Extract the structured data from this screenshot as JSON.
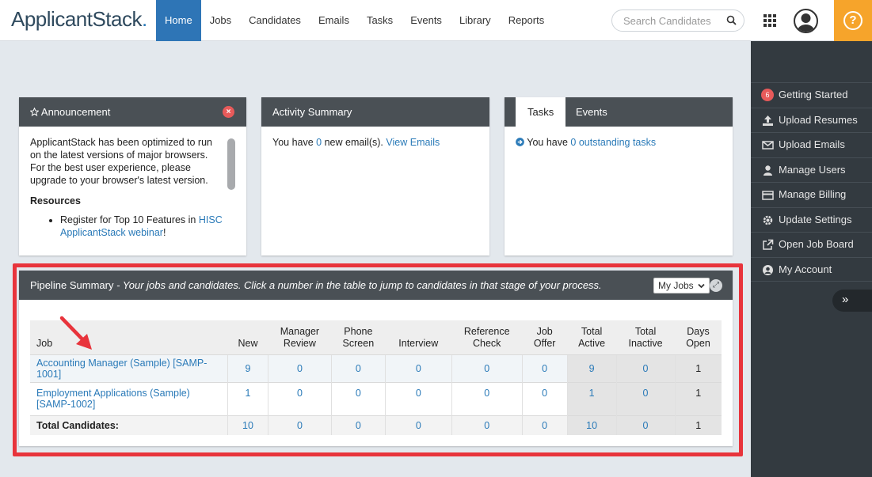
{
  "app": {
    "logo_text": "ApplicantStack",
    "logo_dot": "."
  },
  "nav": {
    "items": [
      {
        "label": "Home",
        "active": true
      },
      {
        "label": "Jobs"
      },
      {
        "label": "Candidates"
      },
      {
        "label": "Emails"
      },
      {
        "label": "Tasks"
      },
      {
        "label": "Events"
      },
      {
        "label": "Library"
      },
      {
        "label": "Reports"
      }
    ]
  },
  "search": {
    "placeholder": "Search Candidates",
    "icon": "search-icon"
  },
  "sidebar": {
    "items": [
      {
        "label": "Getting Started",
        "badge": "6",
        "icon": "badge"
      },
      {
        "label": "Upload Resumes",
        "icon": "upload-icon"
      },
      {
        "label": "Upload Emails",
        "icon": "envelope-icon"
      },
      {
        "label": "Manage Users",
        "icon": "user-icon"
      },
      {
        "label": "Manage Billing",
        "icon": "credit-card-icon"
      },
      {
        "label": "Update Settings",
        "icon": "gear-icon"
      },
      {
        "label": "Open Job Board",
        "icon": "external-link-icon"
      },
      {
        "label": "My Account",
        "icon": "user-circle-icon"
      }
    ],
    "collapse_label": "»"
  },
  "announcement": {
    "title": "Announcement",
    "body": "ApplicantStack has been optimized to run on the latest versions of major browsers. For the best user experience, please upgrade to your browser's latest version.",
    "resources_title": "Resources",
    "resource_prefix": "Register for Top 10 Features in ",
    "resource_link": "HISC ApplicantStack webinar",
    "resource_suffix": "!"
  },
  "activity": {
    "title": "Activity Summary",
    "prefix": "You have ",
    "count": "0",
    "middle": " new email(s). ",
    "link": "View Emails"
  },
  "tasks_panel": {
    "tab_tasks": "Tasks",
    "tab_events": "Events",
    "prefix": "You have ",
    "link": "0 outstanding tasks"
  },
  "pipeline": {
    "title": "Pipeline Summary",
    "subtitle": " - Your jobs and candidates. Click a number in the table to jump to candidates in that stage of your process.",
    "filter": "My Jobs",
    "headers": [
      "Job",
      "New",
      "Manager Review",
      "Phone Screen",
      "Interview",
      "Reference Check",
      "Job Offer",
      "Total Active",
      "Total Inactive",
      "Days Open"
    ],
    "rows": [
      {
        "job": "Accounting Manager (Sample) [SAMP-1001]",
        "values": [
          "9",
          "0",
          "0",
          "0",
          "0",
          "0",
          "9",
          "0",
          "1"
        ]
      },
      {
        "job": "Employment Applications (Sample) [SAMP-1002]",
        "values": [
          "1",
          "0",
          "0",
          "0",
          "0",
          "0",
          "1",
          "0",
          "1"
        ]
      }
    ],
    "total": {
      "job": "Total Candidates:",
      "values": [
        "10",
        "0",
        "0",
        "0",
        "0",
        "0",
        "10",
        "0",
        "1"
      ]
    }
  },
  "colors": {
    "primary": "#2e75b6",
    "accent": "#f6a42b",
    "highlight": "#e8343c",
    "panel_header": "#4a5055",
    "sidebar": "#333a40"
  }
}
